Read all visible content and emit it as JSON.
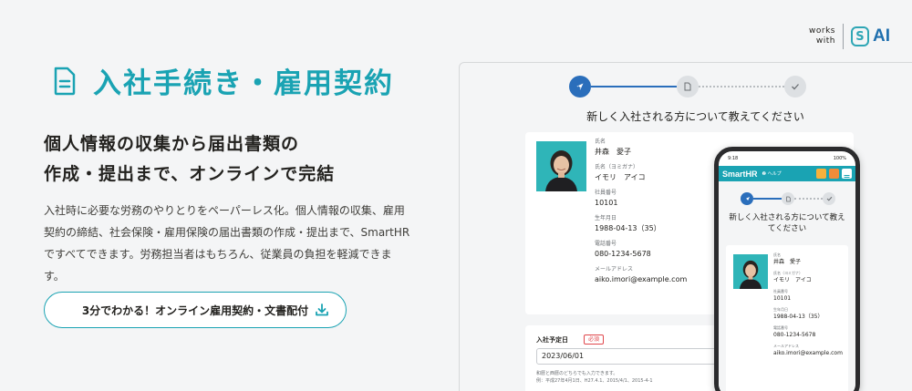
{
  "badge": {
    "works_line1": "works",
    "works_line2": "with",
    "ai_label": "AI"
  },
  "hero": {
    "title": "入社手続き・雇用契約",
    "subtitle_line1": "個人情報の収集から届出書類の",
    "subtitle_line2": "作成・提出まで、オンラインで完結",
    "desc_line1": "入社時に必要な労務のやりとりをペーパーレス化。個人情報の収集、雇用",
    "desc_line2": "契約の締結、社会保険・雇用保険の届出書類の作成・提出まで、SmartHR",
    "desc_line3": "ですべてできます。労務担当者はもちろん、従業員の負担を軽減できま",
    "desc_line4": "す。",
    "cta_label": "3分でわかる！オンライン雇用契約・文書配付"
  },
  "screen": {
    "title": "新しく入社される方について教えてください",
    "fields": [
      {
        "label": "氏名",
        "value": "井森　愛子"
      },
      {
        "label": "氏名（ヨミガナ）",
        "value": "イモリ　アイコ"
      },
      {
        "label": "社員番号",
        "value": "10101"
      },
      {
        "label": "生年月日",
        "value": "1988-04-13（35）"
      },
      {
        "label": "電話番号",
        "value": "080-1234-5678"
      },
      {
        "label": "メールアドレス",
        "value": "aiko.imori@example.com"
      }
    ],
    "join_date_label": "入社予定日",
    "required_badge": "必須",
    "join_date_value": "2023/06/01",
    "hint1": "和暦と西暦のどちらでも入力できます。",
    "hint2": "例：平成27年4月1日、H27.4.1、2015/4/1、2015-4-1"
  },
  "phone": {
    "time": "9:18",
    "battery": "100%",
    "logo": "SmartHR",
    "help": "❷ ヘルプ",
    "title_line1": "新しく入社される方について教え",
    "title_line2": "てください",
    "fields": [
      {
        "label": "氏名",
        "value": "井森　愛子"
      },
      {
        "label": "氏名（ヨミガナ）",
        "value": "イモリ　アイコ"
      },
      {
        "label": "社員番号",
        "value": "10101"
      },
      {
        "label": "生年月日",
        "value": "1988-04-13（35）"
      },
      {
        "label": "電話番号",
        "value": "080-1234-5678"
      },
      {
        "label": "メールアドレス",
        "value": "aiko.imori@example.com"
      }
    ]
  },
  "colors": {
    "accent": "#1aa3b3",
    "primary": "#2a6ebb",
    "required": "#e0474c"
  },
  "icons": [
    "document-icon",
    "download-icon",
    "rocket-icon",
    "file-icon",
    "check-icon",
    "menu-icon"
  ]
}
